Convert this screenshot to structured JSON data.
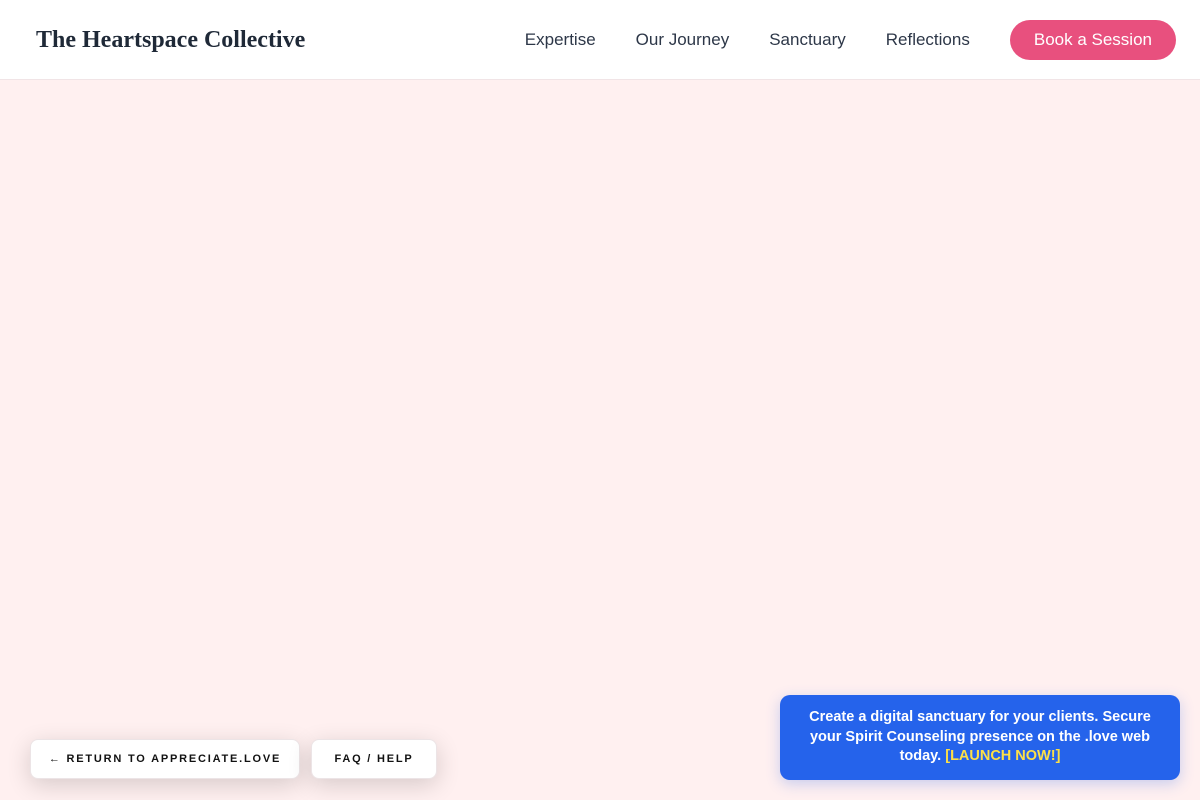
{
  "header": {
    "brand": "The Heartspace Collective",
    "nav": [
      {
        "label": "Expertise"
      },
      {
        "label": "Our Journey"
      },
      {
        "label": "Sanctuary"
      },
      {
        "label": "Reflections"
      }
    ],
    "cta_label": "Book a Session"
  },
  "footer_buttons": {
    "return_label": "← RETURN TO APPRECIATE.LOVE",
    "faq_label": "FAQ / HELP"
  },
  "promo": {
    "text": "Create a digital sanctuary for your clients. Secure your Spirit Counseling presence on the .love web today.",
    "cta": "[LAUNCH NOW!]"
  },
  "colors": {
    "background": "#fff0f0",
    "accent": "#e8507e",
    "promo_bg": "#2563eb",
    "promo_cta": "#fde047"
  }
}
